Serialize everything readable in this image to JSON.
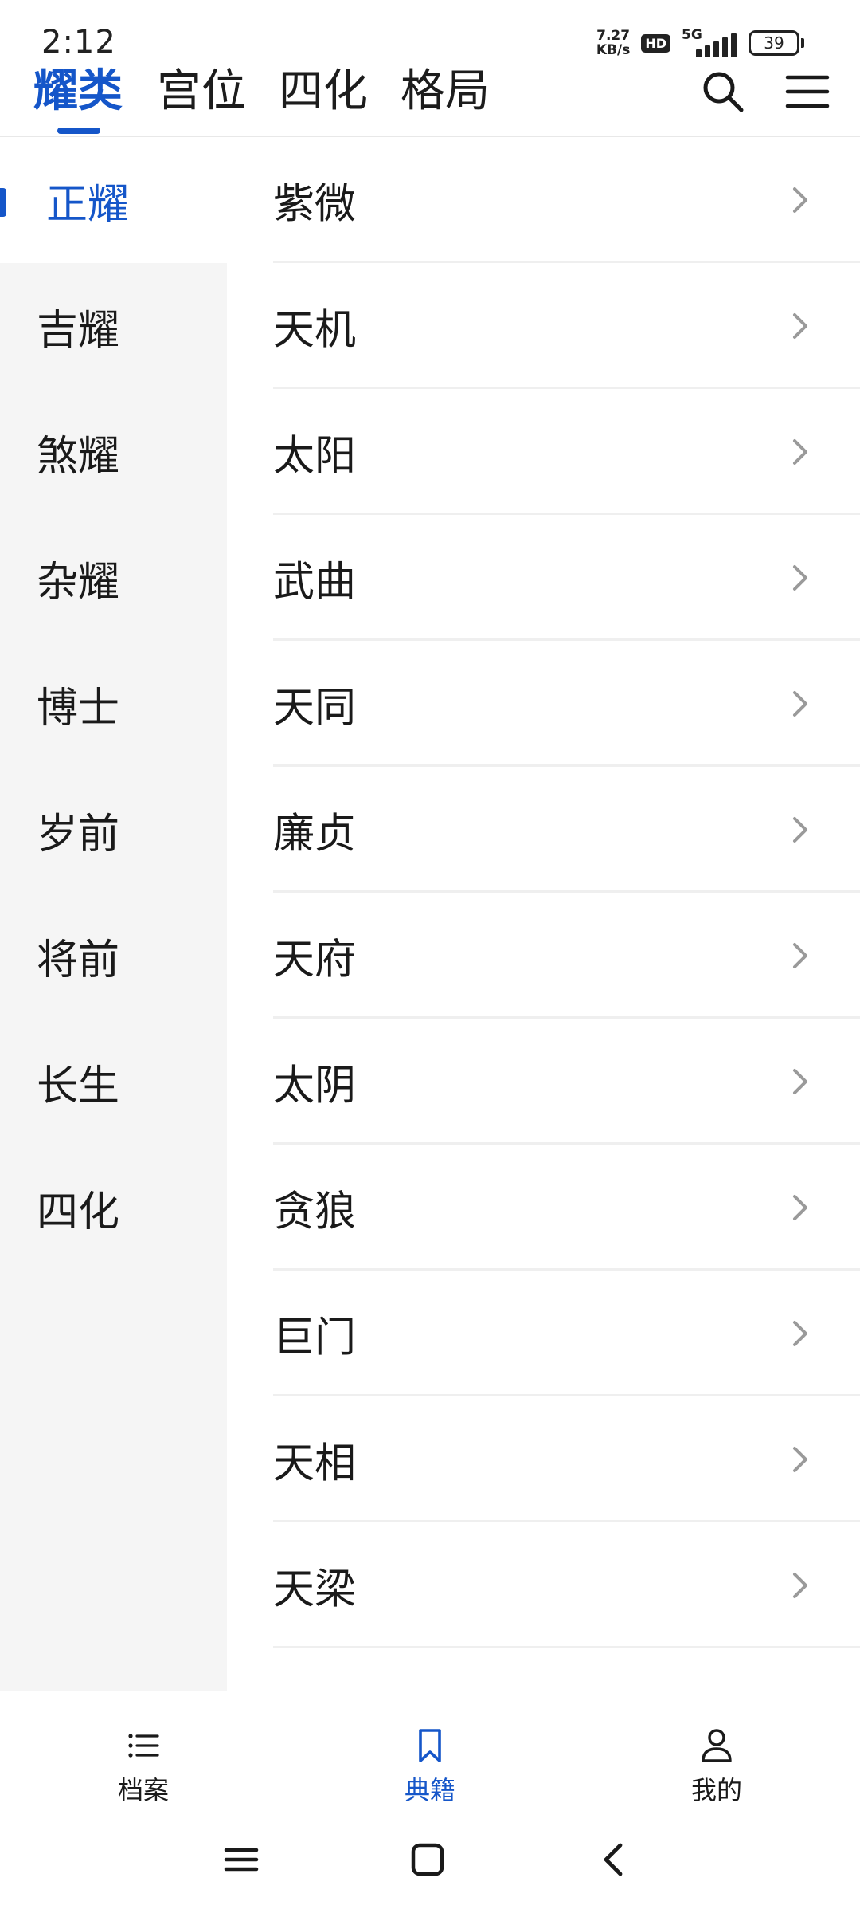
{
  "status": {
    "time": "2:12",
    "net_speed_value": "7.27",
    "net_speed_unit": "KB/s",
    "hd": "HD",
    "network": "5G",
    "battery": "39"
  },
  "header": {
    "tabs": [
      {
        "label": "耀类",
        "active": true
      },
      {
        "label": "宫位",
        "active": false
      },
      {
        "label": "四化",
        "active": false
      },
      {
        "label": "格局",
        "active": false
      }
    ],
    "icons": [
      "search-icon",
      "menu-icon"
    ]
  },
  "sidebar": {
    "items": [
      {
        "label": "正耀",
        "active": true
      },
      {
        "label": "吉耀",
        "active": false
      },
      {
        "label": "煞耀",
        "active": false
      },
      {
        "label": "杂耀",
        "active": false
      },
      {
        "label": "博士",
        "active": false
      },
      {
        "label": "岁前",
        "active": false
      },
      {
        "label": "将前",
        "active": false
      },
      {
        "label": "长生",
        "active": false
      },
      {
        "label": "四化",
        "active": false
      }
    ]
  },
  "list": {
    "items": [
      "紫微",
      "天机",
      "太阳",
      "武曲",
      "天同",
      "廉贞",
      "天府",
      "太阴",
      "贪狼",
      "巨门",
      "天相",
      "天梁"
    ]
  },
  "bottom_nav": {
    "items": [
      {
        "label": "档案",
        "icon": "list-icon",
        "active": false
      },
      {
        "label": "典籍",
        "icon": "bookmark-icon",
        "active": true
      },
      {
        "label": "我的",
        "icon": "user-icon",
        "active": false
      }
    ]
  },
  "colors": {
    "accent": "#1556c9",
    "sidebar_bg": "#f5f5f5",
    "divider": "#efefef",
    "chevron": "#9a9a9a"
  }
}
